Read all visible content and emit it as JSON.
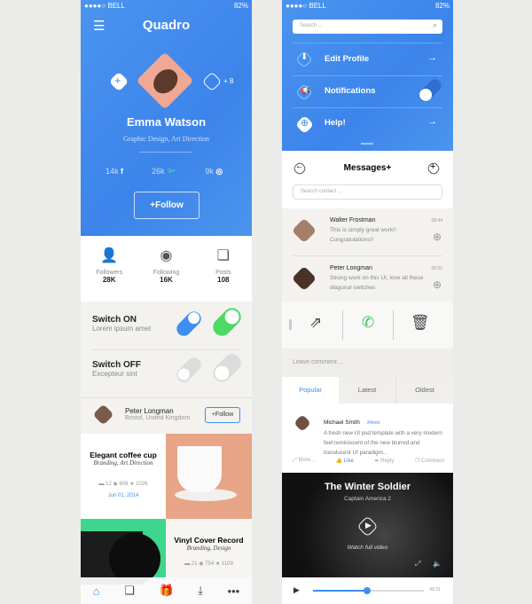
{
  "status": {
    "carrier": "●●●●○ BELL",
    "battery": "82%"
  },
  "profile": {
    "app_title": "Quadro",
    "name": "Emma Watson",
    "role": "Graphic Design, Art Direction",
    "extra_count": "+ 8",
    "social": [
      {
        "count": "14k",
        "icon": "facebook-icon",
        "glyph": "f"
      },
      {
        "count": "26k",
        "icon": "twitter-icon",
        "glyph": "🐦"
      },
      {
        "count": "9k",
        "icon": "dribbble-icon",
        "glyph": "◎"
      }
    ],
    "follow_label": "+Follow",
    "stats": [
      {
        "label": "Followers",
        "value": "28K"
      },
      {
        "label": "Following",
        "value": "16K"
      },
      {
        "label": "Posts",
        "value": "108"
      }
    ]
  },
  "switches": [
    {
      "title": "Switch ON",
      "subtitle": "Lorem ipsum amet",
      "state": "on",
      "colors": [
        "#3d8ef0",
        "#4cd964"
      ]
    },
    {
      "title": "Switch OFF",
      "subtitle": "Excepteur sint",
      "state": "off"
    }
  ],
  "user_card": {
    "name": "Peter Longman",
    "location": "Bristol, United Kingdom",
    "follow_label": "+Follow"
  },
  "cards": [
    {
      "title": "Elegant coffee cup",
      "subtitle": "Branding, Art Direction",
      "comments": "12",
      "views": "608",
      "stars": "1026",
      "date": "Jun 01, 2014"
    },
    {
      "title": "Vinyl Cover Record",
      "subtitle": "Branding, Design",
      "comments": "21",
      "views": "754",
      "stars": "1109"
    }
  ],
  "bottom_nav": [
    "home",
    "layers",
    "gift",
    "download",
    "more"
  ],
  "menu": {
    "search_placeholder": "Search ...",
    "items": [
      {
        "label": "Edit Profile"
      },
      {
        "label": "Notifications"
      },
      {
        "label": "Help!"
      }
    ]
  },
  "messages": {
    "title": "Messages+",
    "search_placeholder": "Search contact ...",
    "items": [
      {
        "name": "Walter Frostman",
        "text": "This is simply great work!! Congratulations!!",
        "time": "08:44"
      },
      {
        "name": "Peter Longman",
        "text": "Strong work on this UI, love all these diagonal switches",
        "time": "06:21"
      }
    ]
  },
  "comment_input": {
    "placeholder": "Leave comment ..."
  },
  "tabs": [
    {
      "label": "Popular",
      "active": true
    },
    {
      "label": "Latest"
    },
    {
      "label": "Oldest"
    }
  ],
  "comment": {
    "author": "Michael Smith",
    "time": "· 34min",
    "text": "A fresh new UI psd template with a very modern feel reminiscent of the new blurred and translucent UI paradigm...",
    "actions": {
      "more": "More...",
      "like": "Like",
      "reply": "Reply",
      "comment": "Comment"
    }
  },
  "video": {
    "title": "The Winter Soldier",
    "subtitle": "Captain America 2",
    "cta": "Watch full video",
    "duration": "06:21",
    "progress": 0.49
  },
  "accent": "#3d8ef0"
}
